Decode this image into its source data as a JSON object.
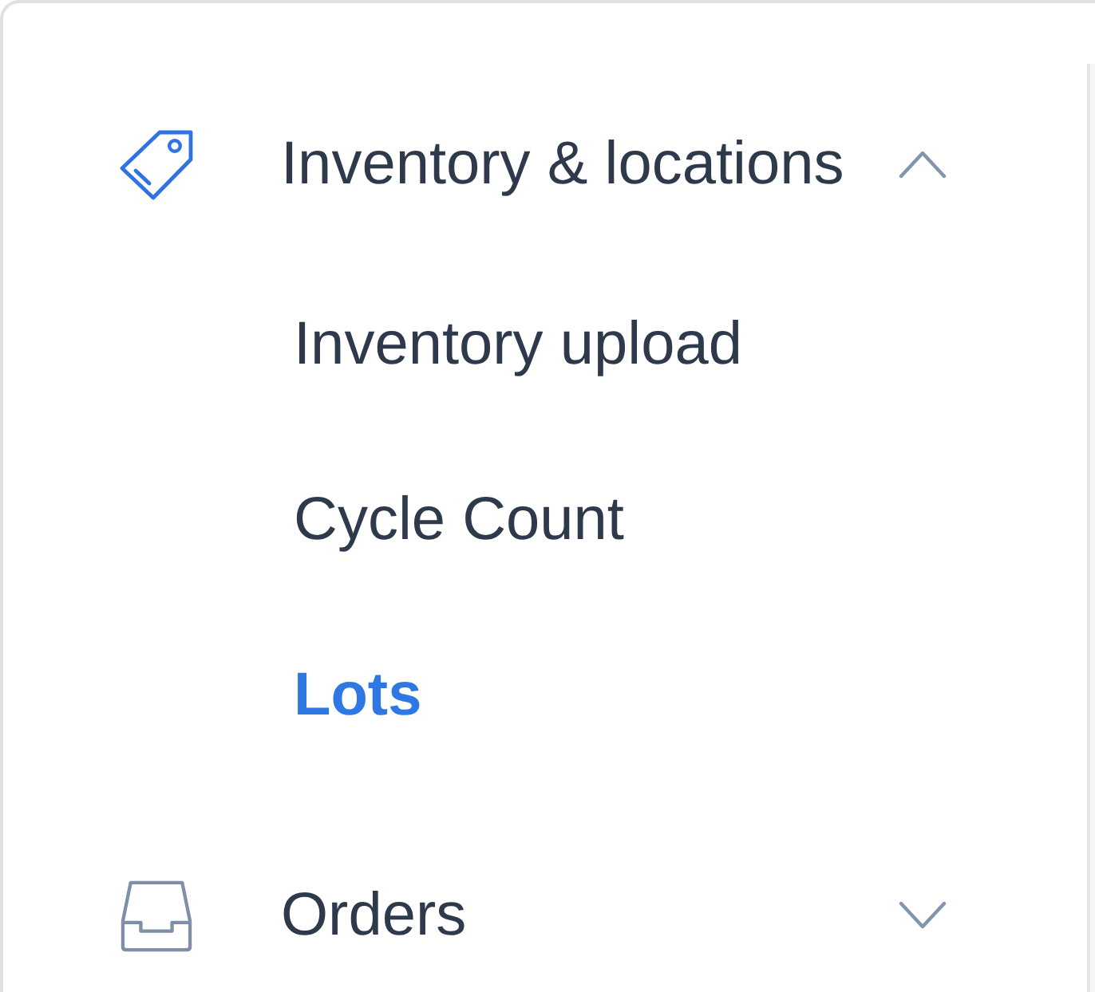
{
  "nav": {
    "sections": [
      {
        "label": "Inventory & locations",
        "active": true,
        "expanded": true,
        "children": [
          {
            "label": "Inventory upload",
            "selected": false
          },
          {
            "label": "Cycle Count",
            "selected": false
          },
          {
            "label": "Lots",
            "selected": true
          }
        ]
      },
      {
        "label": "Orders",
        "active": false,
        "expanded": false
      }
    ]
  }
}
